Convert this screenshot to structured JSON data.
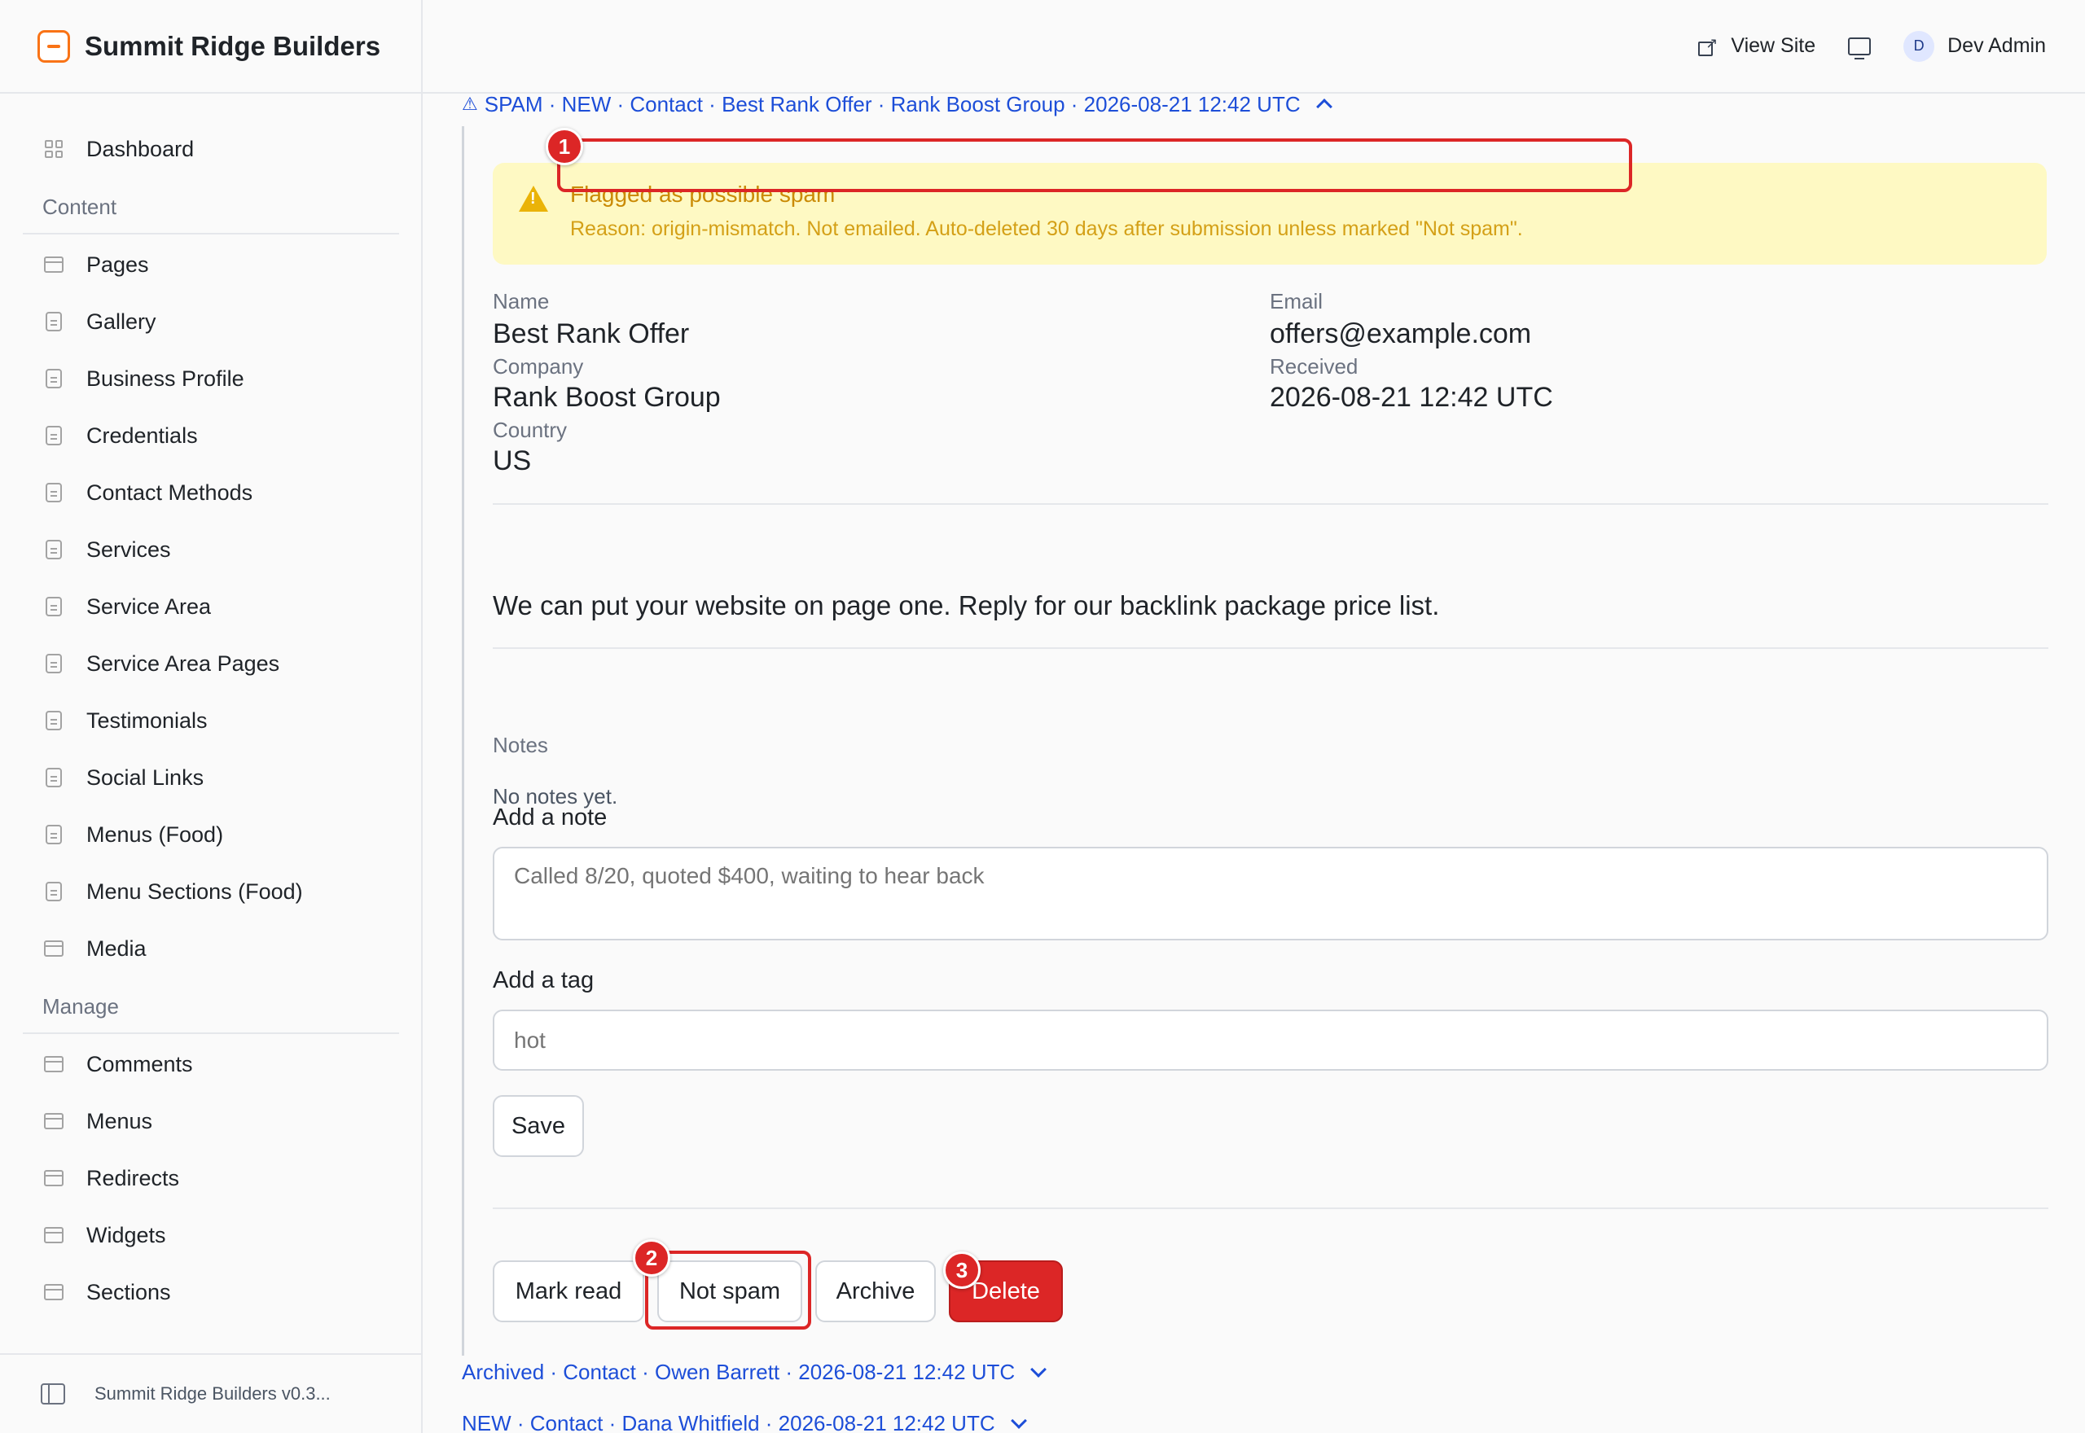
{
  "brand": {
    "title": "Summit Ridge Builders"
  },
  "topbar": {
    "view_site": "View Site",
    "avatar_initial": "D",
    "user_name": "Dev Admin"
  },
  "sidebar": {
    "dashboard": "Dashboard",
    "content_heading": "Content",
    "content_items": [
      "Pages",
      "Gallery",
      "Business Profile",
      "Credentials",
      "Contact Methods",
      "Services",
      "Service Area",
      "Service Area Pages",
      "Testimonials",
      "Social Links",
      "Menus (Food)",
      "Menu Sections (Food)",
      "Media"
    ],
    "manage_heading": "Manage",
    "manage_items": [
      "Comments",
      "Menus",
      "Redirects",
      "Widgets",
      "Sections"
    ],
    "footer": "Summit Ridge Builders v0.3..."
  },
  "entry": {
    "header": "SPAM · NEW · Contact · Best Rank Offer · Rank Boost Group · 2026-08-21 12:42 UTC",
    "alert_title": "Flagged as possible spam",
    "alert_reason": "Reason: origin-mismatch. Not emailed. Auto-deleted 30 days after submission unless marked \"Not spam\".",
    "name_label": "Name",
    "name": "Best Rank Offer",
    "company_label": "Company",
    "company": "Rank Boost Group",
    "country_label": "Country",
    "country": "US",
    "email_label": "Email",
    "email": "offers@example.com",
    "received_label": "Received",
    "received": "2026-08-21 12:42 UTC",
    "message": "We can put your website on page one. Reply for our backlink package price list.",
    "notes_label": "Notes",
    "no_notes": "No notes yet.",
    "add_note_label": "Add a note",
    "note_placeholder": "Called 8/20, quoted $400, waiting to hear back",
    "add_tag_label": "Add a tag",
    "tag_placeholder": "hot",
    "save_label": "Save",
    "actions": {
      "mark_read": "Mark read",
      "not_spam": "Not spam",
      "archive": "Archive",
      "delete": "Delete"
    }
  },
  "other_entries": [
    "Archived · Contact · Owen Barrett · 2026-08-21 12:42 UTC",
    "NEW · Contact · Dana Whitfield · 2026-08-21 12:42 UTC"
  ],
  "markers": [
    "1",
    "2",
    "3"
  ]
}
